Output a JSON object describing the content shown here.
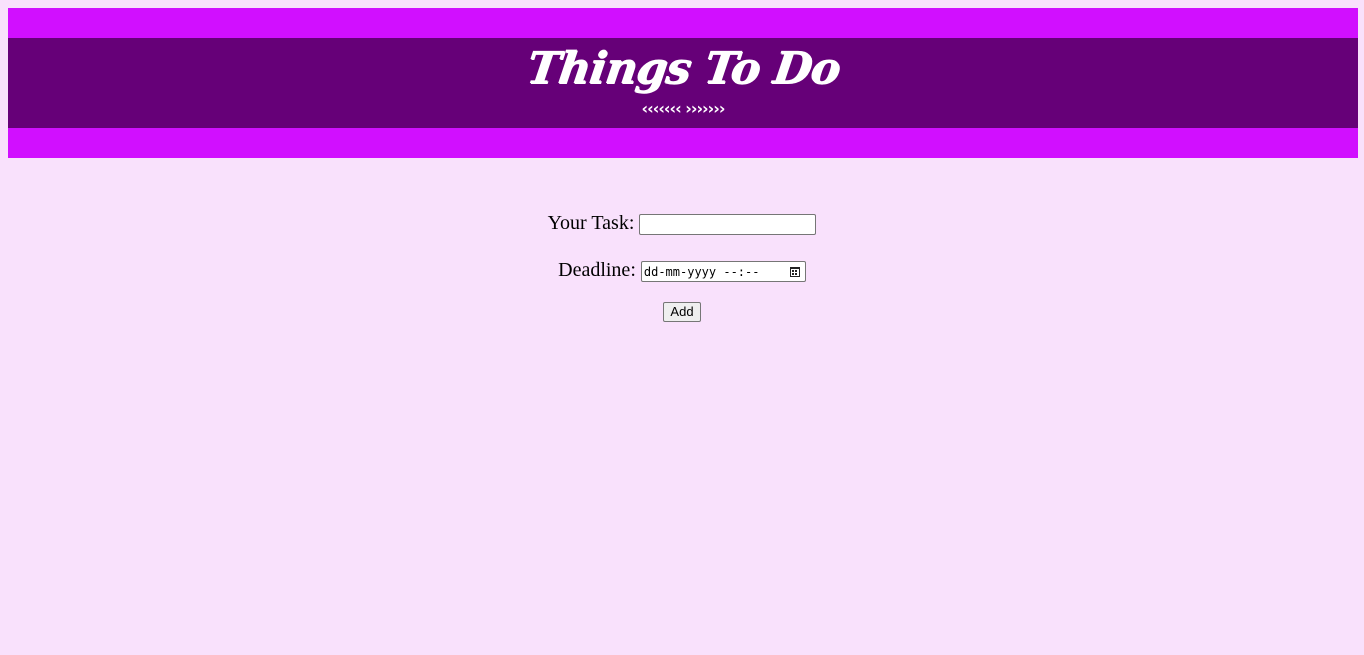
{
  "header": {
    "title": "Things To Do",
    "ornament": "‹‹‹‹‹‹‹ ›››››››",
    "outer_color": "#d10fff",
    "band_color": "#660078"
  },
  "form": {
    "task_label": "Your Task:",
    "task_value": "",
    "deadline_label": "Deadline:",
    "deadline_placeholder": "dd-mm-yyyy --:--",
    "add_label": "Add"
  },
  "page": {
    "background": "#f9e1fc"
  }
}
